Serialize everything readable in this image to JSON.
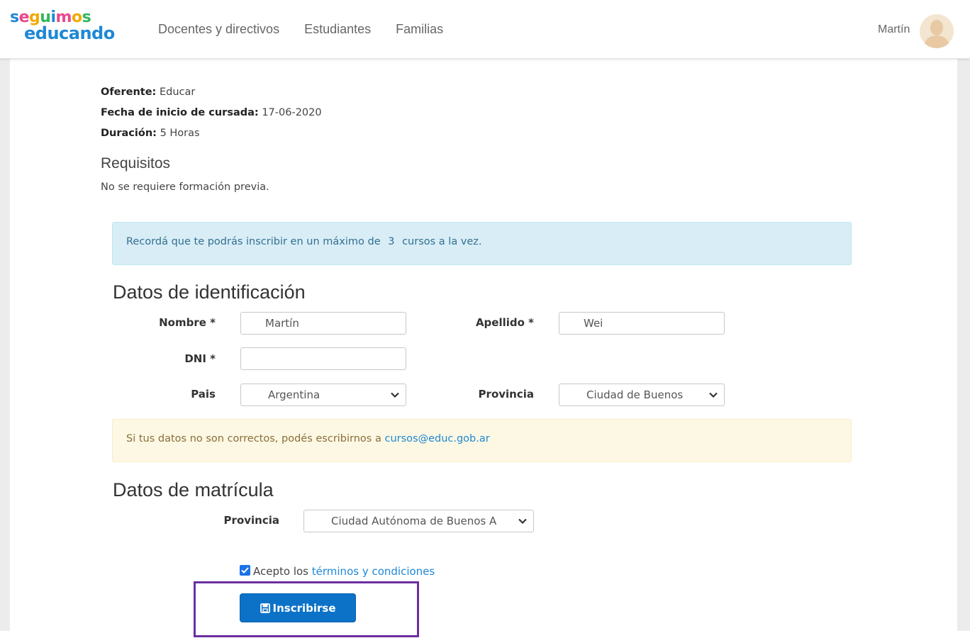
{
  "header": {
    "logo_line1": [
      "s",
      "e",
      "g",
      "u",
      "i",
      "m",
      "o",
      "s"
    ],
    "logo_line1_colors": [
      "#1e88d6",
      "#e8478b",
      "#f2a900",
      "#2eb85c",
      "#1e88d6",
      "#e8478b",
      "#f2a900",
      "#2eb85c"
    ],
    "logo_line2": "educando",
    "nav": [
      "Docentes y directivos",
      "Estudiantes",
      "Familias"
    ],
    "user_name": "Martín"
  },
  "course": {
    "oferente_label": "Oferente:",
    "oferente_value": "Educar",
    "fecha_label": "Fecha de inicio de cursada:",
    "fecha_value": "17-06-2020",
    "duracion_label": "Duración:",
    "duracion_value": "5 Horas",
    "requisitos_title": "Requisitos",
    "requisitos_text": "No se requiere formación previa."
  },
  "info_alert": {
    "before": "Recordá que te podrás inscribir en un máximo de",
    "max": "3",
    "after": "cursos a la vez."
  },
  "identificacion": {
    "title": "Datos de identificación",
    "nombre_label": "Nombre *",
    "nombre_value": "Martín",
    "apellido_label": "Apellido *",
    "apellido_value": "Wei",
    "dni_label": "DNI *",
    "dni_value": "",
    "pais_label": "Pais",
    "pais_value": "Argentina",
    "provincia_label": "Provincia",
    "provincia_value": "Ciudad de Buenos"
  },
  "warn_alert": {
    "text": "Si tus datos no son correctos, podés escribirnos a",
    "email": "cursos@educ.gob.ar"
  },
  "matricula": {
    "title": "Datos de matrícula",
    "provincia_label": "Provincia",
    "provincia_value": "Ciudad Autónoma de Buenos A"
  },
  "terms": {
    "checked": true,
    "prefix": "Acepto los",
    "link": "términos y condiciones"
  },
  "submit": {
    "label": "Inscribirse"
  },
  "colors": {
    "primary": "#0b72c7",
    "highlight": "#6b2fa0"
  }
}
